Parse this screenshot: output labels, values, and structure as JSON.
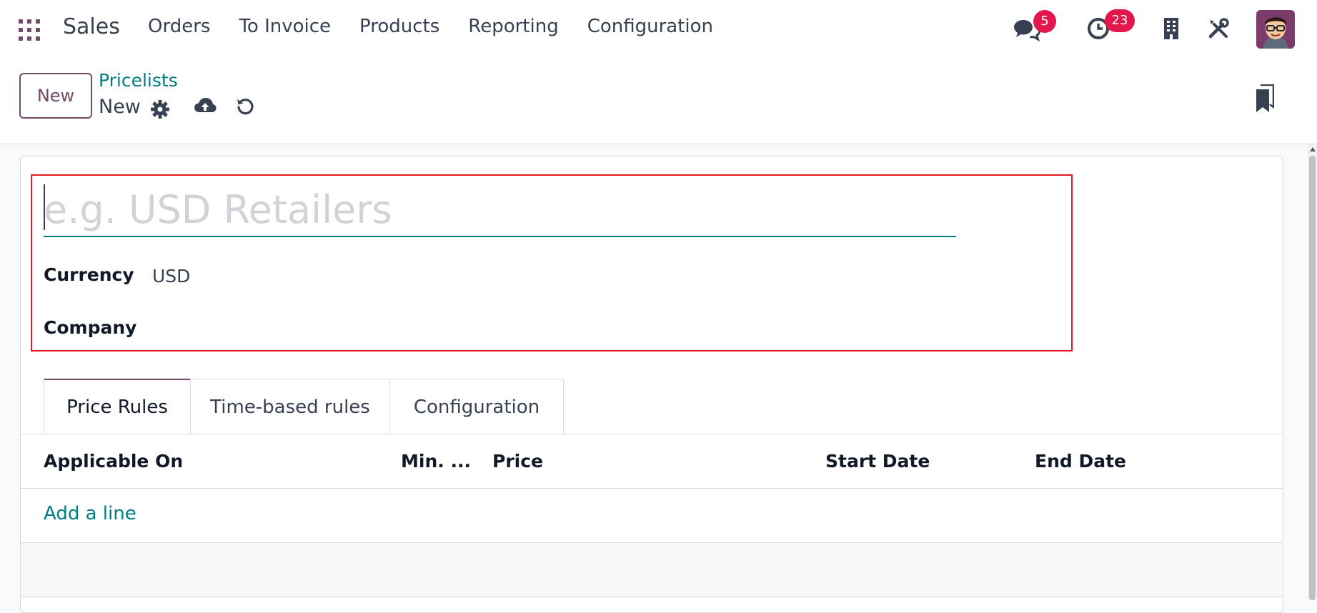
{
  "navbar": {
    "apps_icon": "apps-grid-icon",
    "brand": "Sales",
    "menu": [
      "Orders",
      "To Invoice",
      "Products",
      "Reporting",
      "Configuration"
    ],
    "messages_badge": "5",
    "activities_badge": "23",
    "icons": [
      "chat-icon",
      "clock-icon",
      "company-building-icon",
      "tools-icon"
    ]
  },
  "control_panel": {
    "new_button": "New",
    "breadcrumb": "Pricelists",
    "record_name": "New",
    "icons": [
      "gear-icon",
      "cloud-upload-icon",
      "discard-icon",
      "bookmark-icon"
    ]
  },
  "form": {
    "name_placeholder": "e.g. USD Retailers",
    "currency_label": "Currency",
    "currency_value": "USD",
    "company_label": "Company",
    "company_value": ""
  },
  "tabs": [
    {
      "label": "Price Rules",
      "active": true
    },
    {
      "label": "Time-based rules",
      "active": false
    },
    {
      "label": "Configuration",
      "active": false
    }
  ],
  "table": {
    "columns": [
      "Applicable On",
      "Min. ...",
      "Price",
      "Start Date",
      "End Date"
    ],
    "add_line": "Add a line"
  },
  "colors": {
    "brand": "#714b67",
    "link": "#017e84",
    "badge": "#e3174b",
    "highlight": "#e31b23"
  }
}
